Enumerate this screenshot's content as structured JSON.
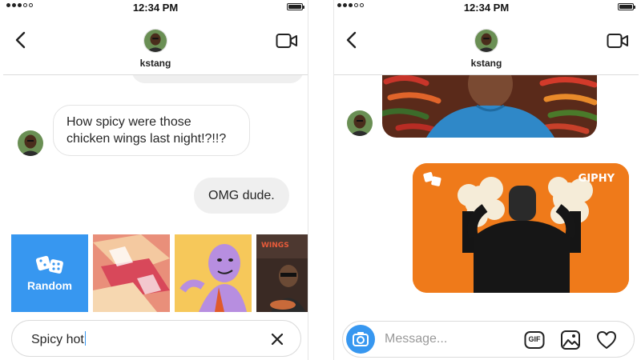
{
  "status_bar": {
    "time": "12:34 PM"
  },
  "left": {
    "header": {
      "username": "kstang"
    },
    "messages": [
      {
        "direction": "incoming",
        "text": "How spicy were those chicken wings last night!?!!?"
      },
      {
        "direction": "outgoing",
        "text": "OMG dude."
      }
    ],
    "gif_picker": {
      "random_label": "Random",
      "tiles": [
        {
          "icon": "dice-icon"
        },
        {
          "icon": "abstract-gif"
        },
        {
          "icon": "cartoon-gif"
        },
        {
          "icon": "wings-gif"
        }
      ]
    },
    "search": {
      "value": "Spicy hot"
    }
  },
  "right": {
    "header": {
      "username": "kstang"
    },
    "gif_watermark": "GIPHY",
    "composer": {
      "placeholder": "Message...",
      "gif_button_label": "GIF"
    }
  },
  "colors": {
    "accent": "#3797f0",
    "bubble_out": "#efefef",
    "gif_orange": "#ef7a1a"
  }
}
